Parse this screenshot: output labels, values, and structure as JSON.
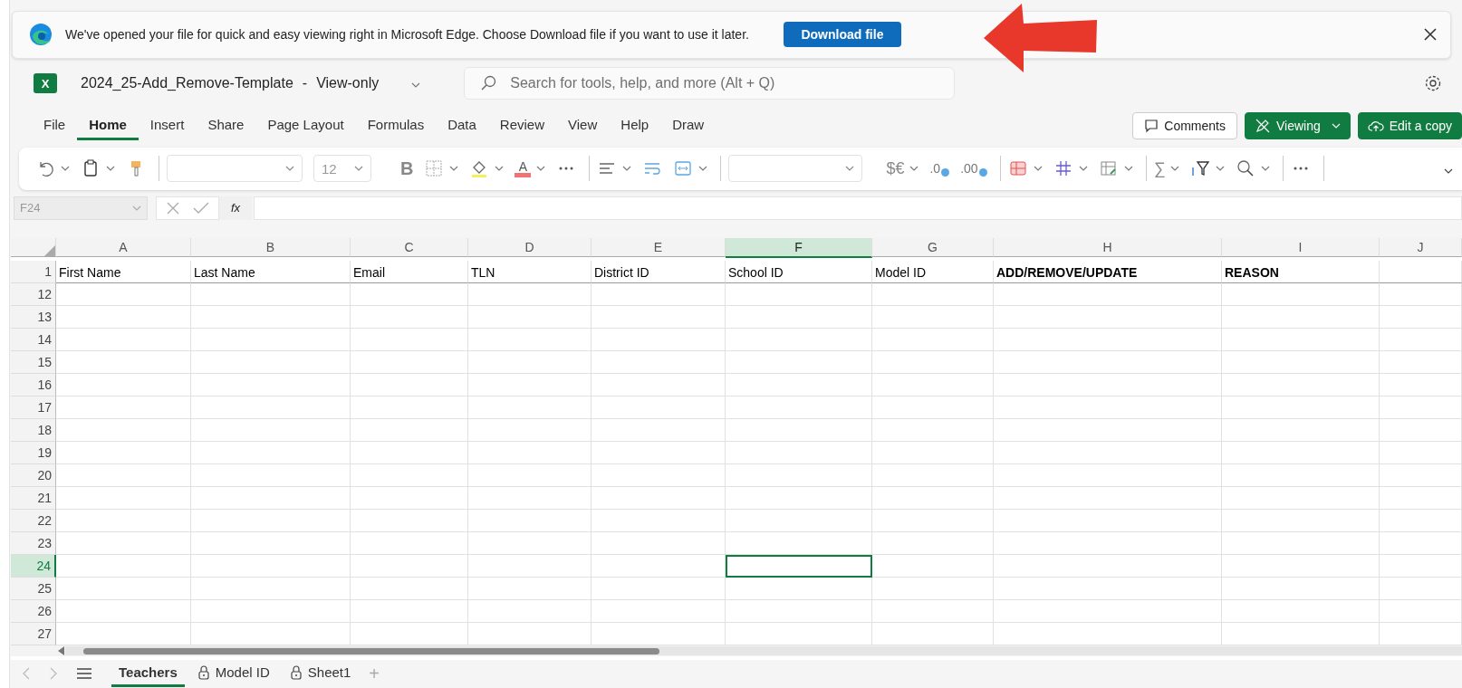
{
  "banner": {
    "message": "We've opened your file for quick and easy viewing right in Microsoft Edge. Choose Download file if you want to use it later.",
    "button": "Download file"
  },
  "header": {
    "logo_letter": "X",
    "file_name": "2024_25-Add_Remove-Template",
    "separator": "-",
    "mode": "View-only",
    "search": {
      "placeholder": "Search for tools, help, and more (Alt + Q)"
    }
  },
  "menu_tabs": [
    {
      "label": "File",
      "selected": false
    },
    {
      "label": "Home",
      "selected": true
    },
    {
      "label": "Insert",
      "selected": false
    },
    {
      "label": "Share",
      "selected": false
    },
    {
      "label": "Page Layout",
      "selected": false
    },
    {
      "label": "Formulas",
      "selected": false
    },
    {
      "label": "Data",
      "selected": false
    },
    {
      "label": "Review",
      "selected": false
    },
    {
      "label": "View",
      "selected": false
    },
    {
      "label": "Help",
      "selected": false
    },
    {
      "label": "Draw",
      "selected": false
    }
  ],
  "actions": [
    {
      "kind": "outline",
      "label": "Comments"
    },
    {
      "kind": "green",
      "label": "Viewing",
      "caret": true
    },
    {
      "kind": "green",
      "label": "Edit a copy"
    }
  ],
  "ribbon": [
    {
      "kind": "undo",
      "caret": true
    },
    {
      "kind": "clipboard",
      "caret": true
    },
    {
      "kind": "painter"
    },
    {
      "kind": "sep"
    },
    {
      "kind": "font_field"
    },
    {
      "kind": "size_field",
      "value": "12"
    },
    {
      "kind": "glyph",
      "label": "B"
    },
    {
      "kind": "borders",
      "caret": true
    },
    {
      "kind": "fill",
      "caret": true
    },
    {
      "kind": "font_color",
      "label": "A",
      "caret": true
    },
    {
      "kind": "more"
    },
    {
      "kind": "sep"
    },
    {
      "kind": "align",
      "caret": true
    },
    {
      "kind": "wrap"
    },
    {
      "kind": "merge",
      "caret": true
    },
    {
      "kind": "sep"
    },
    {
      "kind": "format_field"
    },
    {
      "kind": "glyph",
      "label": "$€",
      "caret": true
    },
    {
      "kind": "decimal",
      "label": ".0"
    },
    {
      "kind": "decimal",
      "label": ".00"
    },
    {
      "kind": "sep"
    },
    {
      "kind": "cond",
      "caret": true
    },
    {
      "kind": "gridlines",
      "caret": true
    },
    {
      "kind": "table",
      "caret": true
    },
    {
      "kind": "sep"
    },
    {
      "kind": "glyph",
      "label": "∑",
      "caret": true
    },
    {
      "kind": "sort",
      "caret": true
    },
    {
      "kind": "find",
      "caret": true
    },
    {
      "kind": "sep"
    },
    {
      "kind": "more"
    },
    {
      "kind": "sep"
    }
  ],
  "formula_bar": {
    "name_box": "F24",
    "fx": "fx"
  },
  "sheet": {
    "columns": [
      {
        "label": "A",
        "selected": false
      },
      {
        "label": "B",
        "selected": false
      },
      {
        "label": "C",
        "selected": false
      },
      {
        "label": "D",
        "selected": false
      },
      {
        "label": "E",
        "selected": false
      },
      {
        "label": "F",
        "selected": true
      },
      {
        "label": "G",
        "selected": false
      },
      {
        "label": "H",
        "selected": false
      },
      {
        "label": "I",
        "selected": false
      },
      {
        "label": "J",
        "selected": false
      }
    ],
    "header_row": {
      "number": "1",
      "cells": [
        {
          "text": "First Name",
          "bold": false
        },
        {
          "text": "Last Name",
          "bold": false
        },
        {
          "text": "Email",
          "bold": false
        },
        {
          "text": "TLN",
          "bold": false
        },
        {
          "text": "District ID",
          "bold": false
        },
        {
          "text": "School ID",
          "bold": false
        },
        {
          "text": "Model ID",
          "bold": false
        },
        {
          "text": "ADD/REMOVE/UPDATE",
          "bold": true
        },
        {
          "text": "REASON",
          "bold": true
        }
      ]
    },
    "rows": [
      {
        "number": "12",
        "selected": false
      },
      {
        "number": "13",
        "selected": false
      },
      {
        "number": "14",
        "selected": false
      },
      {
        "number": "15",
        "selected": false
      },
      {
        "number": "16",
        "selected": false
      },
      {
        "number": "17",
        "selected": false
      },
      {
        "number": "18",
        "selected": false
      },
      {
        "number": "19",
        "selected": false
      },
      {
        "number": "20",
        "selected": false
      },
      {
        "number": "21",
        "selected": false
      },
      {
        "number": "22",
        "selected": false
      },
      {
        "number": "23",
        "selected": false
      },
      {
        "number": "24",
        "selected": true
      },
      {
        "number": "25",
        "selected": false
      },
      {
        "number": "26",
        "selected": false
      },
      {
        "number": "27",
        "selected": false
      }
    ]
  },
  "sheet_tabs": [
    {
      "label": "Teachers",
      "selected": true,
      "locked": false
    },
    {
      "label": "Model ID",
      "selected": false,
      "locked": true
    },
    {
      "label": "Sheet1",
      "selected": false,
      "locked": true
    }
  ],
  "add_sheet": "+"
}
